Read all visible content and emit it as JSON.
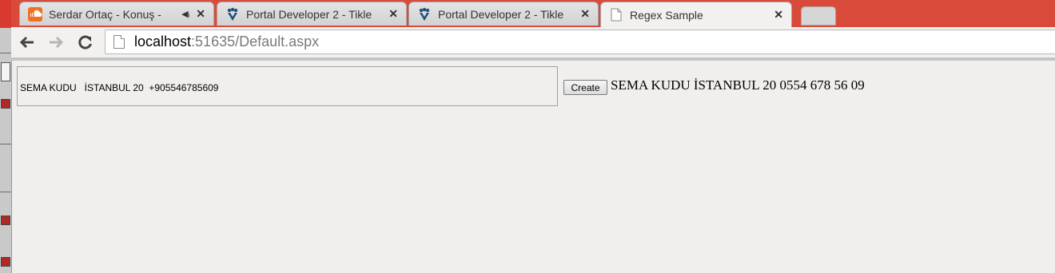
{
  "browser": {
    "tabs": [
      {
        "title": "Serdar Ortaç - Konuş -",
        "favicon": "soundcloud-icon",
        "audio": true,
        "close": "✕"
      },
      {
        "title": "Portal Developer 2 - Tikle",
        "favicon": "jira-icon",
        "close": "✕"
      },
      {
        "title": "Portal Developer 2 - Tikle",
        "favicon": "jira-icon",
        "close": "✕"
      },
      {
        "title": "Regex Sample",
        "favicon": "page-icon",
        "active": true,
        "close": "✕"
      }
    ],
    "address": {
      "host": "localhost",
      "rest": ":51635/Default.aspx"
    },
    "icons": {
      "back": "back-arrow-icon",
      "forward": "forward-arrow-icon",
      "reload": "reload-icon"
    }
  },
  "page": {
    "input_value": "SEMA KUDU   İSTANBUL 20  +905546785609",
    "create_label": "Create",
    "result_text": "SEMA KUDU İSTANBUL 20 0554 678 56 09"
  },
  "colors": {
    "tab_strip": "#d94a3a",
    "soundcloud": "#f26f23",
    "jira": "#205081"
  }
}
